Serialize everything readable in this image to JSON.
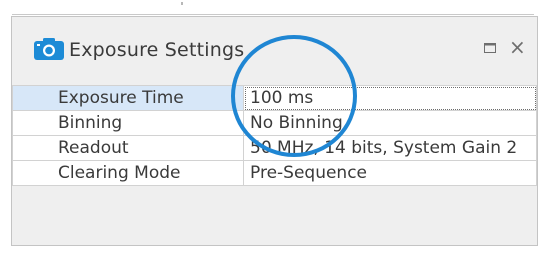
{
  "window": {
    "title": "Exposure Settings",
    "icons": {
      "title_icon": "camera-icon",
      "maximize": "maximize-icon",
      "close": "close-icon"
    },
    "close_glyph": "×"
  },
  "properties": {
    "rows": [
      {
        "label": "Exposure Time",
        "value": "100 ms",
        "selected": true
      },
      {
        "label": "Binning",
        "value": "No Binning",
        "selected": false
      },
      {
        "label": "Readout",
        "value": "50 MHz, 14 bits, System Gain 2",
        "selected": false
      },
      {
        "label": "Clearing Mode",
        "value": "Pre-Sequence",
        "selected": false
      }
    ]
  },
  "colors": {
    "accent": "#1f86d3",
    "selected_row": "#d7e7f8",
    "panel_bg": "#efefef",
    "text": "#3a3a3a"
  }
}
